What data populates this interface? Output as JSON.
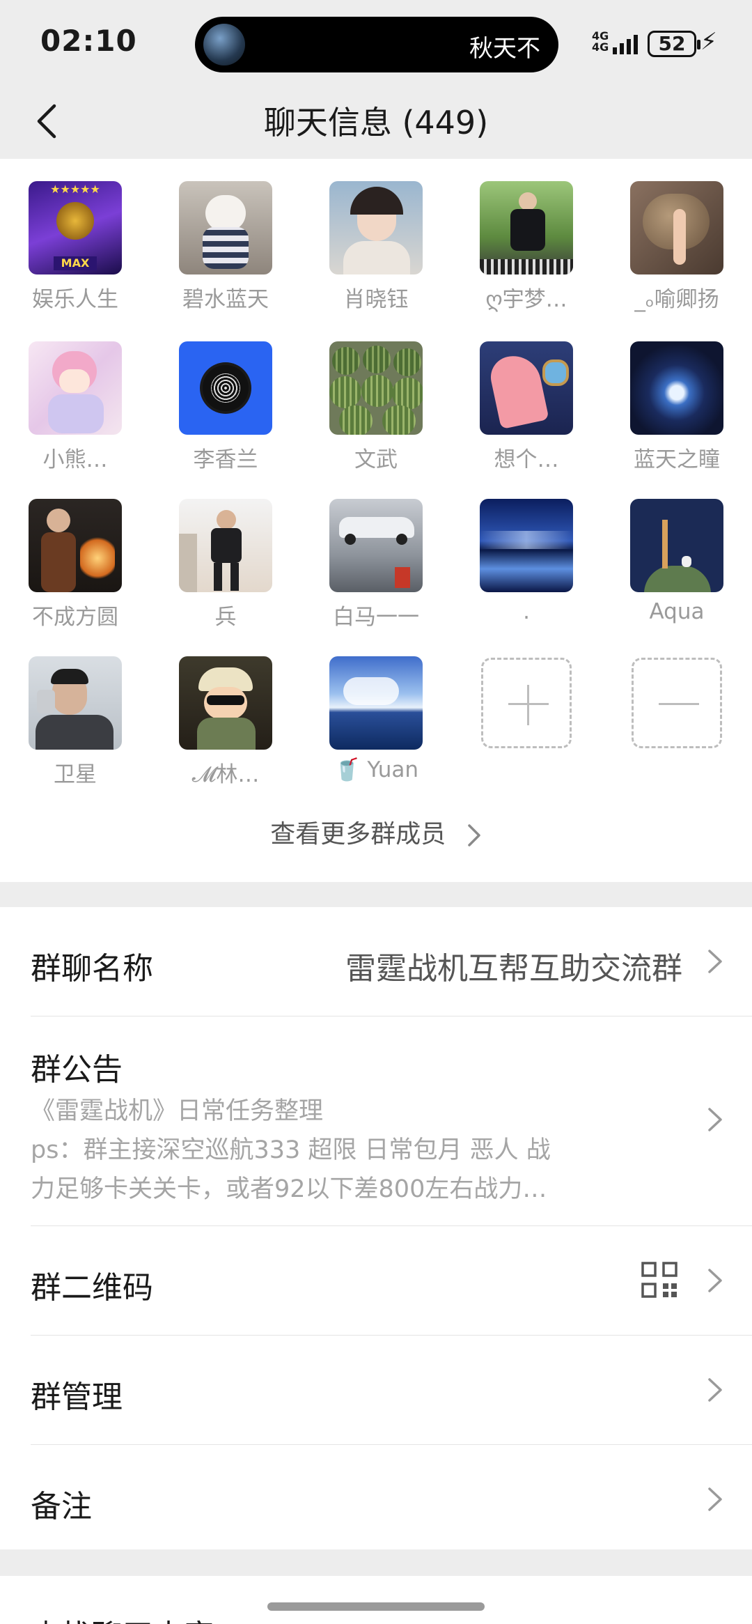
{
  "status_bar": {
    "time": "02:10",
    "island_text": "秋天不",
    "network": "4G",
    "battery": "52"
  },
  "header": {
    "title": "聊天信息 (449)"
  },
  "members": [
    {
      "name": "娱乐人生"
    },
    {
      "name": "碧水蓝天"
    },
    {
      "name": "肖晓钰"
    },
    {
      "name": "ღ宇梦…"
    },
    {
      "name": "_ₒ喻卿扬"
    },
    {
      "name": "小熊…"
    },
    {
      "name": "李香兰"
    },
    {
      "name": "文武"
    },
    {
      "name": "想个…"
    },
    {
      "name": "蓝天之瞳"
    },
    {
      "name": "不成方圆"
    },
    {
      "name": "兵"
    },
    {
      "name": "白马一一"
    },
    {
      "name": "."
    },
    {
      "name": "Aqua"
    },
    {
      "name": "卫星"
    },
    {
      "name": "𝓜林…"
    },
    {
      "name": "🥤 Yuan"
    }
  ],
  "view_more": "查看更多群成员",
  "settings": {
    "group_name_label": "群聊名称",
    "group_name_value": "雷霆战机互帮互助交流群",
    "notice_label": "群公告",
    "notice_line1": "《雷霆战机》日常任务整理",
    "notice_line2": "ps：群主接深空巡航333 超限 日常包月 恶人 战",
    "notice_line3": "力足够卡关关卡，或者92以下差800左右战力…",
    "qrcode_label": "群二维码",
    "manage_label": "群管理",
    "remark_label": "备注"
  },
  "bottom": {
    "search_label": "查找聊天内容"
  },
  "colors": {
    "background": "#ededed",
    "card": "#ffffff",
    "secondary_text": "#9a9a9a"
  }
}
